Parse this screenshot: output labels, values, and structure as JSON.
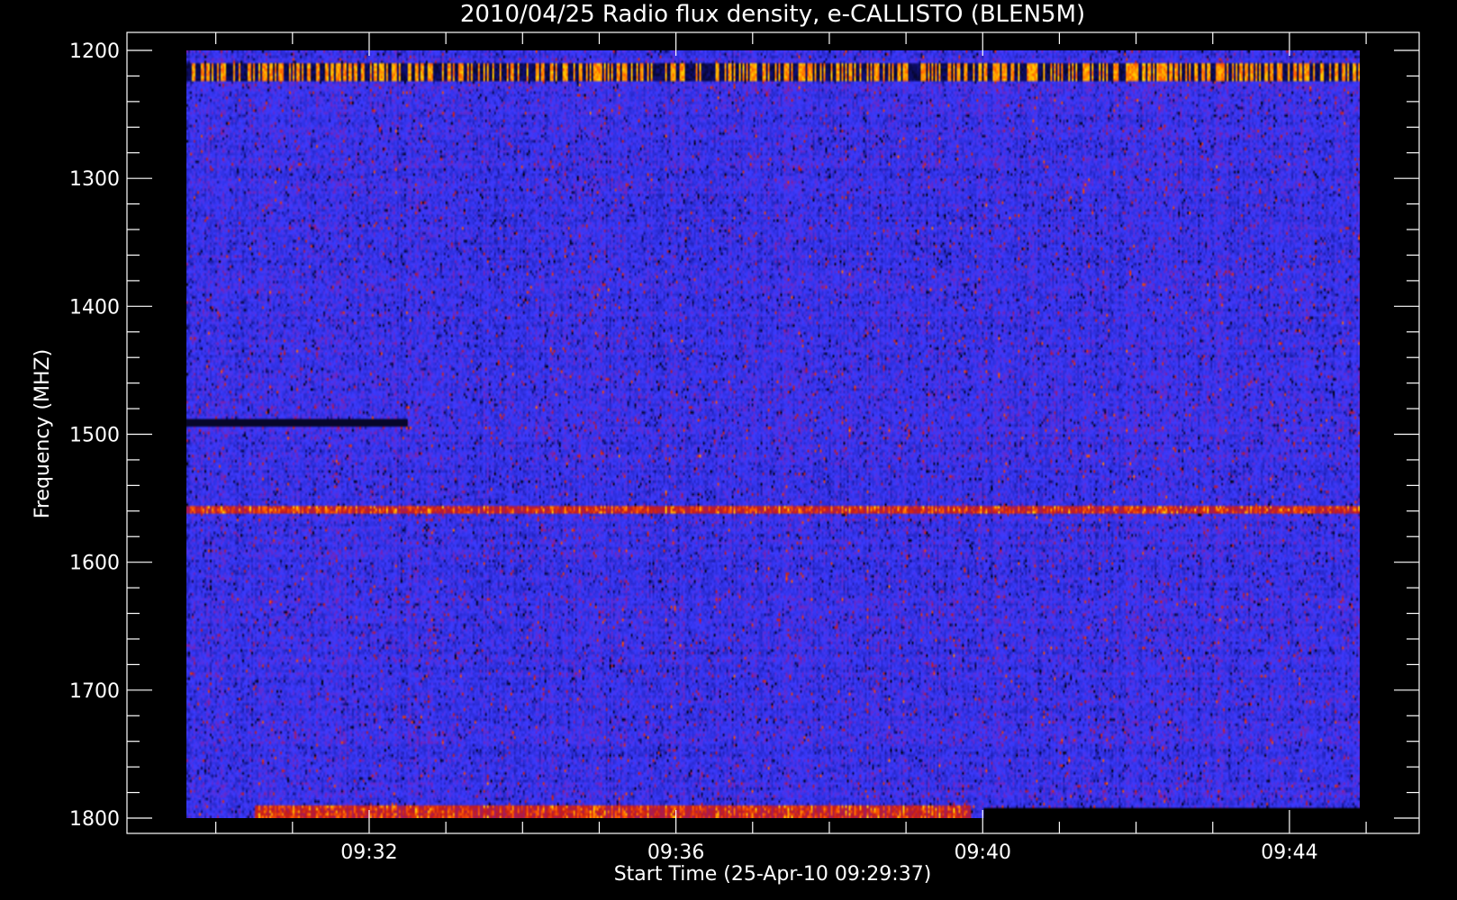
{
  "chart_data": {
    "type": "heatmap",
    "title": "2010/04/25  Radio flux density, e-CALLISTO (BLEN5M)",
    "xlabel": "Start Time (25-Apr-10 09:29:37)",
    "ylabel": "Frequency (MHZ)",
    "x_axis": {
      "unit": "minutes of day",
      "range": [
        "09:29:37",
        "09:45:00"
      ],
      "major_ticks": [
        "09:32",
        "09:36",
        "09:40",
        "09:44"
      ],
      "minor_tick_step_seconds": 60
    },
    "y_axis": {
      "unit": "MHz",
      "range": [
        1200,
        1800
      ],
      "inverted": true,
      "major_ticks": [
        1200,
        1300,
        1400,
        1500,
        1600,
        1700,
        1800
      ],
      "minor_tick_step": 20
    },
    "data_extent": {
      "time_start": "09:29:37",
      "time_end": "09:44:55",
      "freq_min": 1200,
      "freq_max": 1800
    },
    "colormap": [
      "#000000",
      "#10107a",
      "#2a2ad0",
      "#3b3bff",
      "#7a1fb0",
      "#c41a1a",
      "#ff5a00",
      "#ffd400"
    ],
    "features": [
      {
        "name": "upper band intermittent bright lines",
        "freq_mhz": [
          1210,
          1222
        ],
        "time": [
          "09:29:37",
          "09:44:55"
        ],
        "intensity": "high"
      },
      {
        "name": "dark line",
        "freq_mhz": 1490,
        "time": [
          "09:29:37",
          "09:32:30"
        ],
        "intensity": "low"
      },
      {
        "name": "persistent emission line",
        "freq_mhz": 1558,
        "time": [
          "09:29:37",
          "09:44:55"
        ],
        "intensity": "high"
      },
      {
        "name": "low band enhancement",
        "freq_mhz": [
          1790,
          1800
        ],
        "time": [
          "09:30:30",
          "09:39:50"
        ],
        "intensity": "high"
      },
      {
        "name": "no data region",
        "freq_mhz": [
          1792,
          1800
        ],
        "time": [
          "09:40:00",
          "09:44:55"
        ],
        "intensity": "none"
      }
    ],
    "grid": false,
    "legend": "none",
    "background": "#000000"
  }
}
